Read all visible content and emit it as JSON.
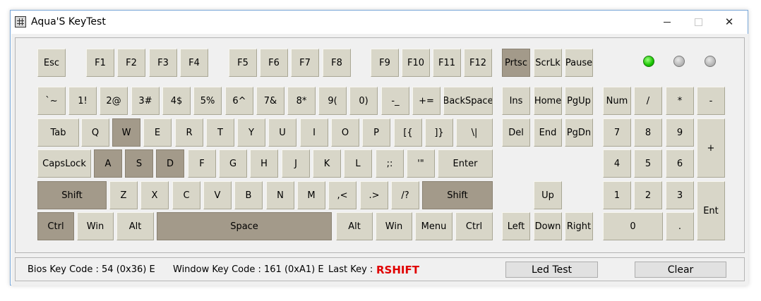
{
  "window": {
    "title": "Aqua'S KeyTest",
    "close_glyph": "✕"
  },
  "keys": {
    "esc": "Esc",
    "f1": "F1",
    "f2": "F2",
    "f3": "F3",
    "f4": "F4",
    "f5": "F5",
    "f6": "F6",
    "f7": "F7",
    "f8": "F8",
    "f9": "F9",
    "f10": "F10",
    "f11": "F11",
    "f12": "F12",
    "prtsc": "Prtsc",
    "scrlk": "ScrLk",
    "pause": "Pause",
    "grave": "`~",
    "d1": "1!",
    "d2": "2@",
    "d3": "3#",
    "d4": "4$",
    "d5": "5%",
    "d6": "6^",
    "d7": "7&",
    "d8": "8*",
    "d9": "9(",
    "d0": "0)",
    "minus": "-_",
    "equal": "+=",
    "backspace": "BackSpace",
    "ins": "Ins",
    "home": "Home",
    "pgup": "PgUp",
    "num": "Num",
    "np_div": "/",
    "np_mul": "*",
    "np_sub": "-",
    "tab": "Tab",
    "q": "Q",
    "w": "W",
    "e": "E",
    "r": "R",
    "t": "T",
    "y": "Y",
    "u": "U",
    "i": "I",
    "o": "O",
    "p": "P",
    "lbracket": "[{",
    "rbracket": "]}",
    "backslash": "\\|",
    "del": "Del",
    "end": "End",
    "pgdn": "PgDn",
    "np7": "7",
    "np8": "8",
    "np9": "9",
    "np_add": "+",
    "capslock": "CapsLock",
    "a": "A",
    "s": "S",
    "d": "D",
    "f": "F",
    "g": "G",
    "h": "H",
    "j": "J",
    "k": "K",
    "l": "L",
    "semicolon": ";:",
    "quote": "'\"",
    "enter": "Enter",
    "np4": "4",
    "np5": "5",
    "np6": "6",
    "lshift": "Shift",
    "z": "Z",
    "x": "X",
    "c": "C",
    "v": "V",
    "b": "B",
    "n": "N",
    "m": "M",
    "comma": ",<",
    "period": ".>",
    "slash": "/?",
    "rshift": "Shift",
    "up": "Up",
    "np1": "1",
    "np2": "2",
    "np3": "3",
    "np_enter": "Ent",
    "lctrl": "Ctrl",
    "lwin": "Win",
    "lalt": "Alt",
    "space": "Space",
    "ralt": "Alt",
    "rwin": "Win",
    "menu": "Menu",
    "rctrl": "Ctrl",
    "left": "Left",
    "down": "Down",
    "right": "Right",
    "np0": "0",
    "np_dot": "."
  },
  "pressed_keys": [
    "prtsc",
    "w",
    "a",
    "s",
    "d",
    "lshift",
    "rshift",
    "lctrl",
    "space"
  ],
  "leds": {
    "num_lock": "on",
    "caps_lock": "off",
    "scroll_lock": "off"
  },
  "status": {
    "bios_code": "Bios Key Code : 54 (0x36) E",
    "window_code": "Window Key Code : 161 (0xA1) E",
    "last_key_label": "Last Key :",
    "last_key_value": "RSHIFT",
    "led_test_label": "Led Test",
    "clear_label": "Clear"
  },
  "colors": {
    "key_face": "#d8d6c8",
    "key_pressed": "#a39a8a",
    "led_on": "#19c400",
    "last_key_text": "#e00000"
  }
}
